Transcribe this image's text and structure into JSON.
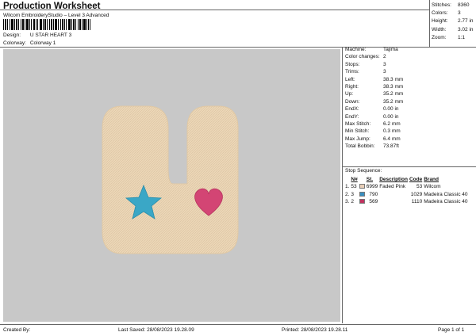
{
  "header": {
    "title": "Production Worksheet",
    "subtitle": "Wilcom EmbroideryStudio – Level 3 Advanced"
  },
  "design_info": {
    "design_label": "Design:",
    "design_value": "U STAR HEART 3",
    "colorway_label": "Colorway:",
    "colorway_value": "Colorway 1"
  },
  "summary": [
    {
      "label": "Stitches:",
      "value": "8360"
    },
    {
      "label": "Colors:",
      "value": "3"
    },
    {
      "label": "Height:",
      "value": "2.77 in"
    },
    {
      "label": "Width:",
      "value": "3.02 in"
    },
    {
      "label": "Zoom:",
      "value": "1:1"
    }
  ],
  "machine_info": [
    {
      "label": "Machine:",
      "value": "Tajima"
    },
    {
      "label": "Color changes:",
      "value": "2"
    },
    {
      "label": "Stops:",
      "value": "3"
    },
    {
      "label": "Trims:",
      "value": "3"
    },
    {
      "label": "Left:",
      "value": "38.3 mm"
    },
    {
      "label": "Right:",
      "value": "38.3 mm"
    },
    {
      "label": "Up:",
      "value": "35.2 mm"
    },
    {
      "label": "Down:",
      "value": "35.2 mm"
    },
    {
      "label": "EndX:",
      "value": "0.00 in"
    },
    {
      "label": "EndY:",
      "value": "0.00 in"
    },
    {
      "label": "Max Stitch:",
      "value": "6.2 mm"
    },
    {
      "label": "Min Stitch:",
      "value": "0.3 mm"
    },
    {
      "label": "Max Jump:",
      "value": "6.4 mm"
    },
    {
      "label": "Total Bobbin:",
      "value": "73.87ft"
    }
  ],
  "stop_sequence": {
    "title": "Stop Sequence:",
    "headers": [
      "N#",
      "St.",
      "Description",
      "Code",
      "Brand"
    ],
    "rows": [
      {
        "seq": "1.",
        "n": "53",
        "color": "#e9cfb8",
        "st": "6999",
        "desc": "Faded Pink",
        "code": "53",
        "brand": "Wilcom"
      },
      {
        "seq": "2.",
        "n": "3",
        "color": "#3a8fc0",
        "st": "790",
        "desc": "",
        "code": "1029",
        "brand": "Madeira Classic 40"
      },
      {
        "seq": "3.",
        "n": "2",
        "color": "#c0335f",
        "st": "569",
        "desc": "",
        "code": "1110",
        "brand": "Madeira Classic 40"
      }
    ]
  },
  "design_colors": {
    "background": "#c8c8c8",
    "u_fill": "#ecd7b7",
    "star": "#3aa7c6",
    "heart": "#d34574"
  },
  "footer": {
    "created_by": "Created By:",
    "last_saved": "Last Saved: 28/08/2023 19.28.09",
    "printed": "Printed: 28/08/2023 19.28.11",
    "page": "Page 1 of 1"
  }
}
